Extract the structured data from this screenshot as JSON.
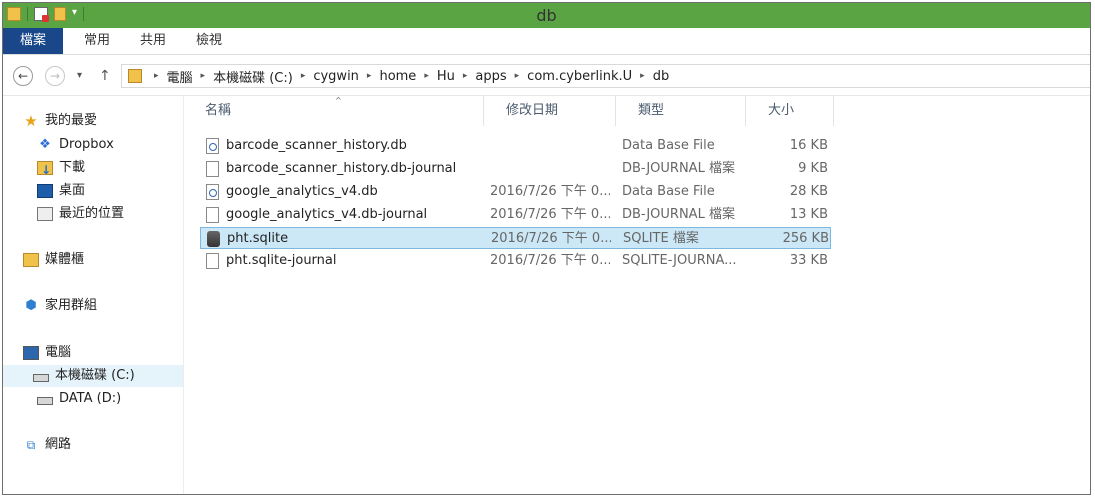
{
  "window": {
    "title": "db"
  },
  "quick_access": {
    "dropdown_glyph": "▾",
    "icons": [
      "folder-icon",
      "properties-icon",
      "new-folder-icon"
    ]
  },
  "ribbon": {
    "tabs": [
      "檔案",
      "常用",
      "共用",
      "檢視"
    ]
  },
  "nav": {
    "back": "←",
    "forward": "→",
    "recent": "▾",
    "up": "↑"
  },
  "address": {
    "crumbs": [
      "電腦",
      "本機磁碟 (C:)",
      "cygwin",
      "home",
      "Hu",
      "apps",
      "com.cyberlink.U",
      "db"
    ],
    "separator": "▸"
  },
  "sidebar": {
    "items": [
      {
        "label": "我的最愛",
        "icon": "star-icon"
      },
      {
        "label": "Dropbox",
        "icon": "dropbox-icon"
      },
      {
        "label": "下載",
        "icon": "download-folder-icon"
      },
      {
        "label": "桌面",
        "icon": "desktop-icon"
      },
      {
        "label": "最近的位置",
        "icon": "recent-places-icon"
      },
      {
        "label": "媒體櫃",
        "icon": "library-icon"
      },
      {
        "label": "家用群組",
        "icon": "homegroup-icon"
      },
      {
        "label": "電腦",
        "icon": "computer-icon"
      },
      {
        "label": "本機磁碟 (C:)",
        "icon": "local-disk-icon",
        "selected": true
      },
      {
        "label": "DATA (D:)",
        "icon": "drive-icon"
      },
      {
        "label": "網路",
        "icon": "network-icon"
      }
    ]
  },
  "columns": {
    "name": "名稱",
    "date": "修改日期",
    "type": "類型",
    "size": "大小",
    "sort_glyph": "^"
  },
  "files": [
    {
      "name": "barcode_scanner_history.db",
      "date": "",
      "type": "Data Base File",
      "size": "16 KB",
      "icon": "db-file-icon"
    },
    {
      "name": "barcode_scanner_history.db-journal",
      "date": "",
      "type": "DB-JOURNAL 檔案",
      "size": "9 KB",
      "icon": "blank-file-icon"
    },
    {
      "name": "google_analytics_v4.db",
      "date": "2016/7/26 下午 0...",
      "type": "Data Base File",
      "size": "28 KB",
      "icon": "db-file-icon"
    },
    {
      "name": "google_analytics_v4.db-journal",
      "date": "2016/7/26 下午 0...",
      "type": "DB-JOURNAL 檔案",
      "size": "13 KB",
      "icon": "blank-file-icon"
    },
    {
      "name": "pht.sqlite",
      "date": "2016/7/26 下午 0...",
      "type": "SQLITE 檔案",
      "size": "256 KB",
      "icon": "sqlite-file-icon",
      "selected": true
    },
    {
      "name": "pht.sqlite-journal",
      "date": "2016/7/26 下午 0...",
      "type": "SQLITE-JOURNA...",
      "size": "33 KB",
      "icon": "blank-file-icon"
    }
  ],
  "colors": {
    "titlebar": "#5aa444",
    "file_tab": "#19478a",
    "selection": "#cce8f7"
  }
}
